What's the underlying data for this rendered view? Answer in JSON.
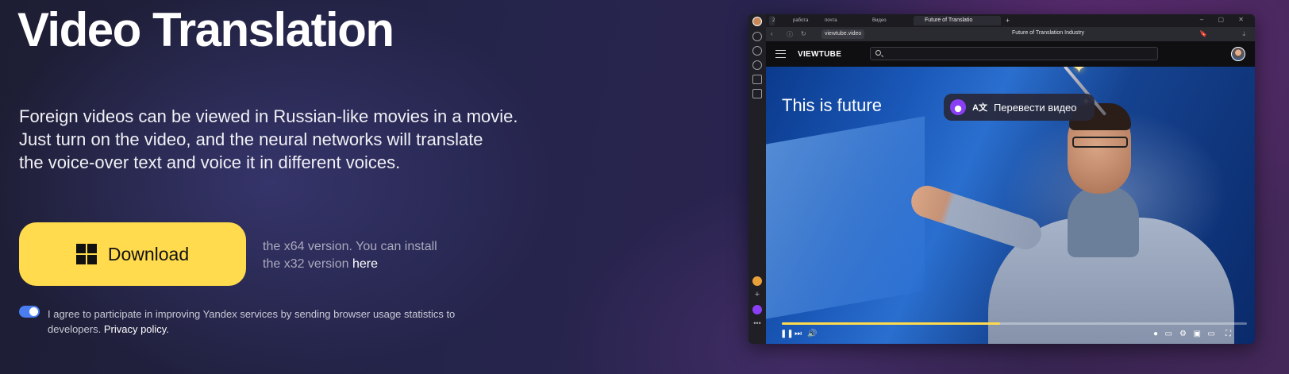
{
  "hero": {
    "title": "Video Translation",
    "description_lines": [
      "Foreign videos can be viewed in Russian-like movies in a movie.",
      "Just turn on the video, and the neural networks will translate",
      "the voice-over text and voice it in different voices."
    ]
  },
  "download": {
    "button_label": "Download",
    "icon": "windows-icon",
    "accent": "#ffdb4d",
    "note_line1": "the x64 version. You can install",
    "note_line2_prefix": "the x32 version ",
    "note_link": "here"
  },
  "consent": {
    "toggle_on": true,
    "text": "I agree to participate in improving Yandex services by sending browser usage statistics to developers.",
    "link": "Privacy policy."
  },
  "browser": {
    "tabs": [
      "работа",
      "почта",
      "Видео",
      "Future of Translatio"
    ],
    "tab_count_badge": "2",
    "address_url": "viewtube.video",
    "page_title": "Future of Translation Industry",
    "site_logo": "VIEWTUBE",
    "video_title": "This is future",
    "translate_button": "Перевести видео",
    "progress_fraction": 0.47
  }
}
